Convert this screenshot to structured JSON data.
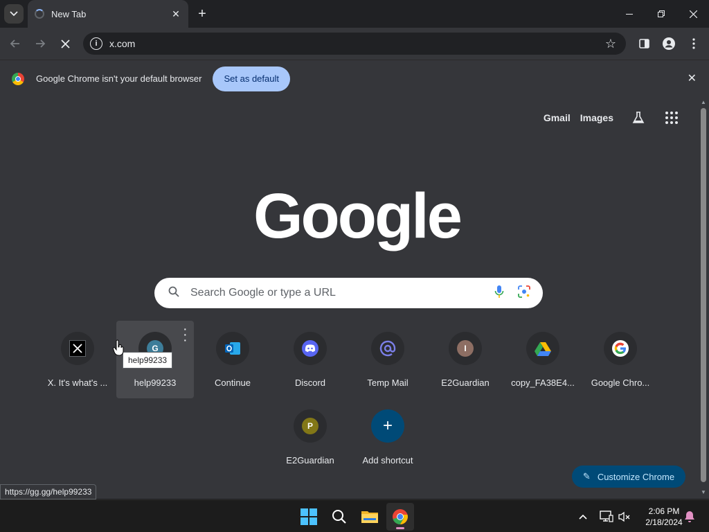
{
  "browser": {
    "tab": {
      "title": "New Tab"
    },
    "address": {
      "url": "x.com"
    },
    "infobar": {
      "message": "Google Chrome isn't your default browser",
      "button_label": "Set as default"
    }
  },
  "ntp": {
    "top_links": [
      "Gmail",
      "Images"
    ],
    "logo_text": "Google",
    "search": {
      "placeholder": "Search Google or type a URL"
    },
    "shortcuts": [
      {
        "title": "X. It's what's ...",
        "icon": "x-logo-icon"
      },
      {
        "title": "help99233",
        "icon": "letter-g-icon",
        "letter": "G",
        "color": "#3d7d99"
      },
      {
        "title": "Continue",
        "icon": "outlook-icon"
      },
      {
        "title": "Discord",
        "icon": "discord-icon"
      },
      {
        "title": "Temp Mail",
        "icon": "at-sign-icon"
      },
      {
        "title": "E2Guardian",
        "icon": "letter-i-icon",
        "letter": "I",
        "color": "#8d6e63"
      },
      {
        "title": "copy_FA38E4...",
        "icon": "google-drive-icon"
      },
      {
        "title": "Google Chro...",
        "icon": "google-g-icon"
      },
      {
        "title": "E2Guardian",
        "icon": "letter-p-icon",
        "letter": "P",
        "color": "#827717"
      },
      {
        "title": "Add shortcut",
        "icon": "plus-icon"
      }
    ],
    "tooltip": "help99233",
    "customize_label": "Customize Chrome",
    "status_url": "https://gg.gg/help99233"
  },
  "taskbar": {
    "time": "2:06 PM",
    "date": "2/18/2024"
  },
  "colors": {
    "accent": "#a8c7fa",
    "customize_bg": "#004a77",
    "ntp_bg": "#35363a"
  }
}
